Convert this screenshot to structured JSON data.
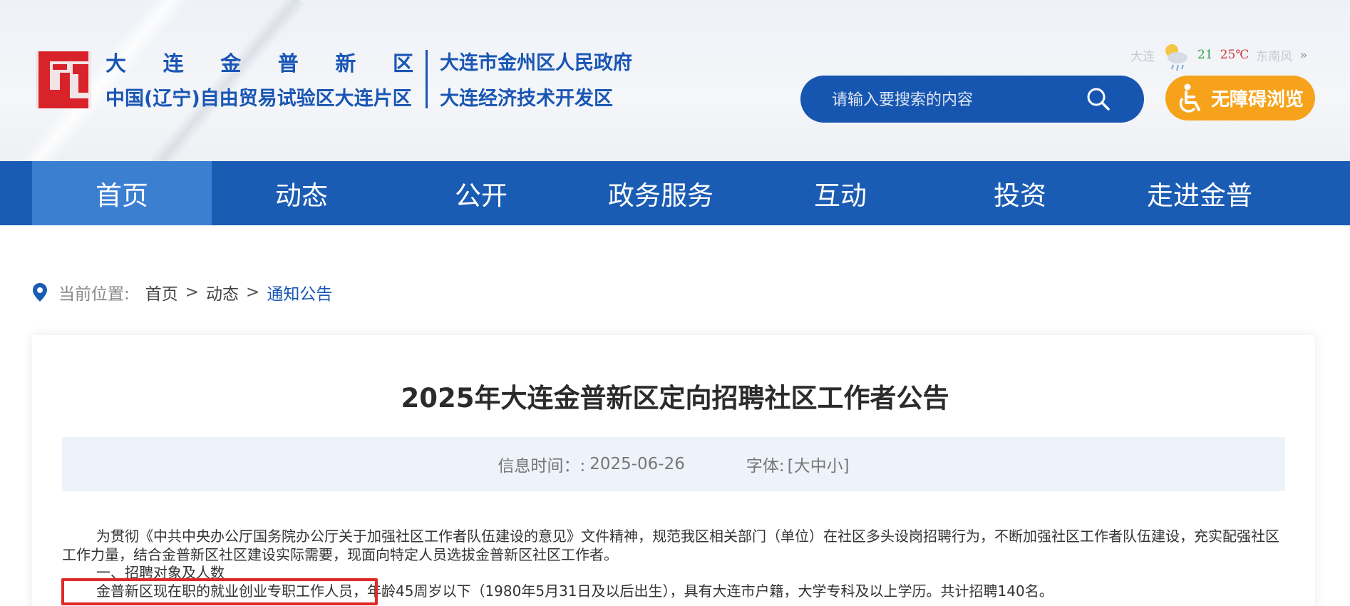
{
  "header": {
    "logo_name_chars": [
      "大",
      "连",
      "金",
      "普",
      "新",
      "区"
    ],
    "logo_subtitle": "中国(辽宁)自由贸易试验区大连片区",
    "gov_name": "大连市金州区人民政府",
    "dev_zone_name": "大连经济技术开发区",
    "weather": {
      "city": "大连",
      "icon": "cloudy-rain-icon",
      "low": "21",
      "high": "25℃",
      "wind": "东南风",
      "more_icon": "double-chevron-right-icon"
    },
    "search": {
      "placeholder": "请输入要搜索的内容",
      "icon": "search-icon"
    },
    "accessibility_label": "无障碍浏览"
  },
  "nav": {
    "items": [
      {
        "label": "首页"
      },
      {
        "label": "动态"
      },
      {
        "label": "公开"
      },
      {
        "label": "政务服务"
      },
      {
        "label": "互动"
      },
      {
        "label": "投资"
      },
      {
        "label": "走进金普"
      }
    ],
    "active_index": 0
  },
  "breadcrumb": {
    "label": "当前位置:",
    "items": [
      "首页",
      "动态",
      "通知公告"
    ],
    "separator": ">"
  },
  "article": {
    "title": "2025年大连金普新区定向招聘社区工作者公告",
    "date_label": "信息时间：:",
    "date_value": "2025-06-26",
    "font_label": "字体:",
    "font_options": "[大中小]",
    "paragraphs": [
      "为贯彻《中共中央办公厅国务院办公厅关于加强社区工作者队伍建设的意见》文件精神，规范我区相关部门（单位）在社区多头设岗招聘行为，不断加强社区工作者队伍建设，充实配强社区工作力量，结合金普新区社区建设实际需要，现面向特定人员选拔金普新区社区工作者。",
      "一、招聘对象及人数",
      "金普新区现在职的就业创业专职工作人员，年龄45周岁以下（1980年5月31日及以后出生），具有大连市户籍，大学专科及以上学历。共计招聘140名。"
    ]
  },
  "colors": {
    "brand_blue": "#1a5cb4",
    "nav_active": "#3b7fd1",
    "accessibility_orange": "#f6a21b",
    "highlight_red": "#e02a2a",
    "logo_red": "#d8232a"
  }
}
